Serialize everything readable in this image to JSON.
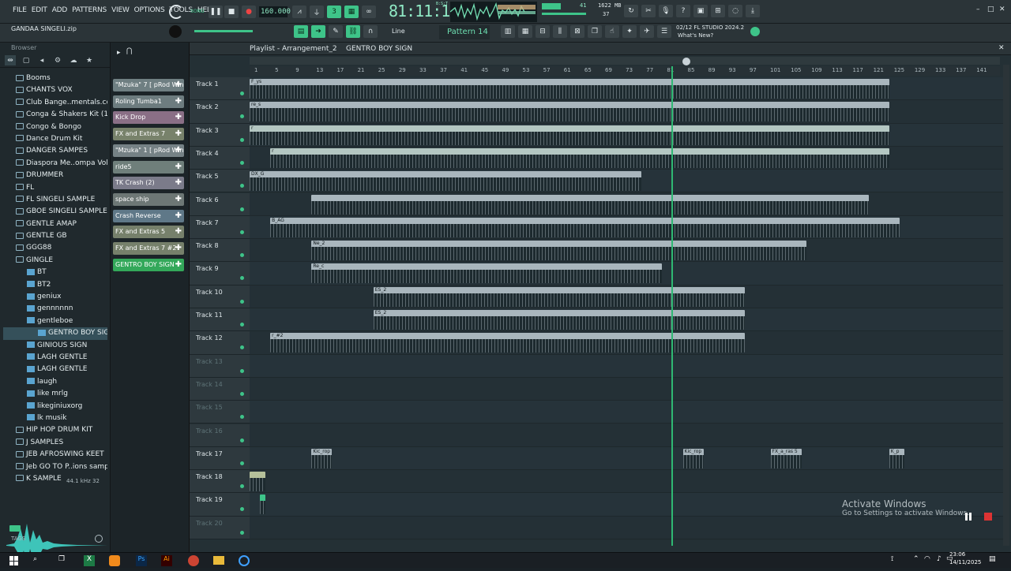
{
  "menu": [
    "FILE",
    "EDIT",
    "ADD",
    "PATTERNS",
    "VIEW",
    "OPTIONS",
    "TOOLS",
    "HELP"
  ],
  "transport": {
    "mode": "SONG",
    "tempo": "160.000",
    "time": "81:11:10",
    "time_small": "B:S:T",
    "memory": "1622 MB",
    "cpu": "41",
    "voices": "37"
  },
  "hint_project": "GANDAA SINGELI.zip",
  "snap_mode": "Line",
  "pattern": "Pattern 14",
  "news": {
    "date": "02/12",
    "title": "FL STUDIO 2024.2",
    "sub": "What's New?"
  },
  "browser": {
    "title": "Browser",
    "items": [
      {
        "label": "Booms",
        "type": "folder",
        "lvl": 0
      },
      {
        "label": "CHANTS VOX",
        "type": "folder",
        "lvl": 0
      },
      {
        "label": "Club Bange..mentals.com)",
        "type": "folder",
        "lvl": 0
      },
      {
        "label": "Conga & Shakers Kit (1)",
        "type": "folder",
        "lvl": 0
      },
      {
        "label": "Congo & Bongo",
        "type": "folder",
        "lvl": 0
      },
      {
        "label": "Dance Drum Kit",
        "type": "folder",
        "lvl": 0
      },
      {
        "label": "DANGER SAMPES",
        "type": "folder",
        "lvl": 0
      },
      {
        "label": "Diaspora Me..ompa Vol. 2",
        "type": "folder",
        "lvl": 0
      },
      {
        "label": "DRUMMER",
        "type": "folder",
        "lvl": 0
      },
      {
        "label": "FL",
        "type": "folder",
        "lvl": 0
      },
      {
        "label": "FL SINGELI SAMPLE",
        "type": "folder",
        "lvl": 0
      },
      {
        "label": "GBOE SINGELI SAMPLE",
        "type": "folder",
        "lvl": 0
      },
      {
        "label": "GENTLE AMAP",
        "type": "folder",
        "lvl": 0
      },
      {
        "label": "GENTLE GB",
        "type": "folder",
        "lvl": 0
      },
      {
        "label": "GGG88",
        "type": "folder",
        "lvl": 0
      },
      {
        "label": "GINGLE",
        "type": "folder",
        "lvl": 0
      },
      {
        "label": "BT",
        "type": "file",
        "lvl": 1
      },
      {
        "label": "BT2",
        "type": "file",
        "lvl": 1
      },
      {
        "label": "geniux",
        "type": "file",
        "lvl": 1
      },
      {
        "label": "gennnnnn",
        "type": "file",
        "lvl": 1
      },
      {
        "label": "gentleboe",
        "type": "file",
        "lvl": 1
      },
      {
        "label": "GENTRO BOY SIGN",
        "type": "file",
        "lvl": 2,
        "selected": true
      },
      {
        "label": "GINIOUS SIGN",
        "type": "file",
        "lvl": 1
      },
      {
        "label": "LAGH GENTLE",
        "type": "file",
        "lvl": 1
      },
      {
        "label": "LAGH GENTLE",
        "type": "file",
        "lvl": 1
      },
      {
        "label": "laugh",
        "type": "file",
        "lvl": 1
      },
      {
        "label": "like mrlg",
        "type": "file",
        "lvl": 1
      },
      {
        "label": "likeginiuxorg",
        "type": "file",
        "lvl": 1
      },
      {
        "label": "lk musik",
        "type": "file",
        "lvl": 1
      },
      {
        "label": "HIP HOP DRUM KIT",
        "type": "folder",
        "lvl": 0
      },
      {
        "label": "J SAMPLES",
        "type": "folder",
        "lvl": 0
      },
      {
        "label": "JEB AFROSWING KEET",
        "type": "folder",
        "lvl": 0
      },
      {
        "label": "Jeb GO TO P..ions samples",
        "type": "folder",
        "lvl": 0
      },
      {
        "label": "K SAMPLE",
        "type": "folder",
        "lvl": 0
      }
    ],
    "sample_info": "44.1 kHz 32",
    "tags": "TAGS"
  },
  "channels": [
    {
      "label": "\"Mzuka\" 7 [ pRod Win..",
      "color": "#6f7f82"
    },
    {
      "label": "Roling Tumba1",
      "color": "#6d7c7f"
    },
    {
      "label": "Kick Drop",
      "color": "#8a6f86"
    },
    {
      "label": "FX and Extras 7",
      "color": "#78826b"
    },
    {
      "label": "\"Mzuka\" 1 [ pRod Win..",
      "color": "#758185"
    },
    {
      "label": "ride5",
      "color": "#6f7f7b"
    },
    {
      "label": "TK Crash (2)",
      "color": "#7b7b8a"
    },
    {
      "label": "space ship",
      "color": "#6d7775"
    },
    {
      "label": "Crash Reverse",
      "color": "#5f7888"
    },
    {
      "label": "FX and Extras 5",
      "color": "#76806b"
    },
    {
      "label": "FX and Extras 7 #2",
      "color": "#76806b"
    },
    {
      "label": "GENTRO BOY SIGN",
      "color": "#33a85a"
    }
  ],
  "playlist": {
    "title": "Playlist - Arrangement_2",
    "current": "GENTRO BOY SIGN",
    "ruler": [
      "1",
      "5",
      "9",
      "13",
      "17",
      "21",
      "25",
      "29",
      "33",
      "37",
      "41",
      "45",
      "49",
      "53",
      "57",
      "61",
      "65",
      "69",
      "73",
      "77",
      "81",
      "85",
      "89",
      "93",
      "97",
      "101",
      "105",
      "109",
      "113",
      "117",
      "121",
      "125",
      "129",
      "133",
      "137",
      "141"
    ],
    "tracks": [
      "Track 1",
      "Track 2",
      "Track 3",
      "Track 4",
      "Track 5",
      "Track 6",
      "Track 7",
      "Track 8",
      "Track 9",
      "Track 10",
      "Track 11",
      "Track 12",
      "Track 13",
      "Track 14",
      "Track 15",
      "Track 16",
      "Track 17",
      "Track 18",
      "Track 19",
      "Track 20"
    ]
  },
  "clips": [
    {
      "track": 0,
      "start": 1,
      "end": 125,
      "label": "F_ys",
      "color": "#a9b6bd"
    },
    {
      "track": 1,
      "start": 1,
      "end": 125,
      "label": "re_s",
      "color": "#a9b6bd"
    },
    {
      "track": 2,
      "start": 1,
      "end": 125,
      "label": "r",
      "color": "#b4c7c2"
    },
    {
      "track": 3,
      "start": 5,
      "end": 125,
      "label": "r",
      "color": "#b4c7c2"
    },
    {
      "track": 4,
      "start": 1,
      "end": 77,
      "label": "DX_G",
      "color": "#a9b6bd"
    },
    {
      "track": 5,
      "start": 13,
      "end": 121,
      "label": "",
      "color": "#a9b6bd"
    },
    {
      "track": 6,
      "start": 5,
      "end": 127,
      "label": "B_AG",
      "color": "#a9b6bd"
    },
    {
      "track": 7,
      "start": 13,
      "end": 109,
      "label": "Ne_2",
      "color": "#a9b6bd"
    },
    {
      "track": 8,
      "start": 13,
      "end": 81,
      "label": "Re_c",
      "color": "#a9b6bd"
    },
    {
      "track": 9,
      "start": 25,
      "end": 97,
      "label": "ES_2",
      "color": "#a9b6bd"
    },
    {
      "track": 10,
      "start": 25,
      "end": 97,
      "label": "ES_2",
      "color": "#a9b6bd"
    },
    {
      "track": 11,
      "start": 5,
      "end": 97,
      "label": "r_#2",
      "color": "#a9b6bd"
    },
    {
      "track": 16,
      "start": 13,
      "end": 17,
      "label": "Kic_rop",
      "color": "#a9b6bd"
    },
    {
      "track": 16,
      "start": 85,
      "end": 89,
      "label": "Kic_rop",
      "color": "#a9b6bd"
    },
    {
      "track": 16,
      "start": 102,
      "end": 108,
      "label": "FX_a_ras 5",
      "color": "#a9b6bd"
    },
    {
      "track": 16,
      "start": 125,
      "end": 128,
      "label": "K_p",
      "color": "#a9b6bd"
    },
    {
      "track": 17,
      "start": 1,
      "end": 4,
      "label": "",
      "color": "#b5c09a"
    },
    {
      "track": 18,
      "start": 3,
      "end": 4,
      "label": "",
      "color": "#3ec489"
    }
  ],
  "taskbar": {
    "time": "23:06",
    "date": "14/11/2025"
  },
  "watermark": {
    "title": "Activate Windows",
    "sub": "Go to Settings to activate Windows."
  }
}
